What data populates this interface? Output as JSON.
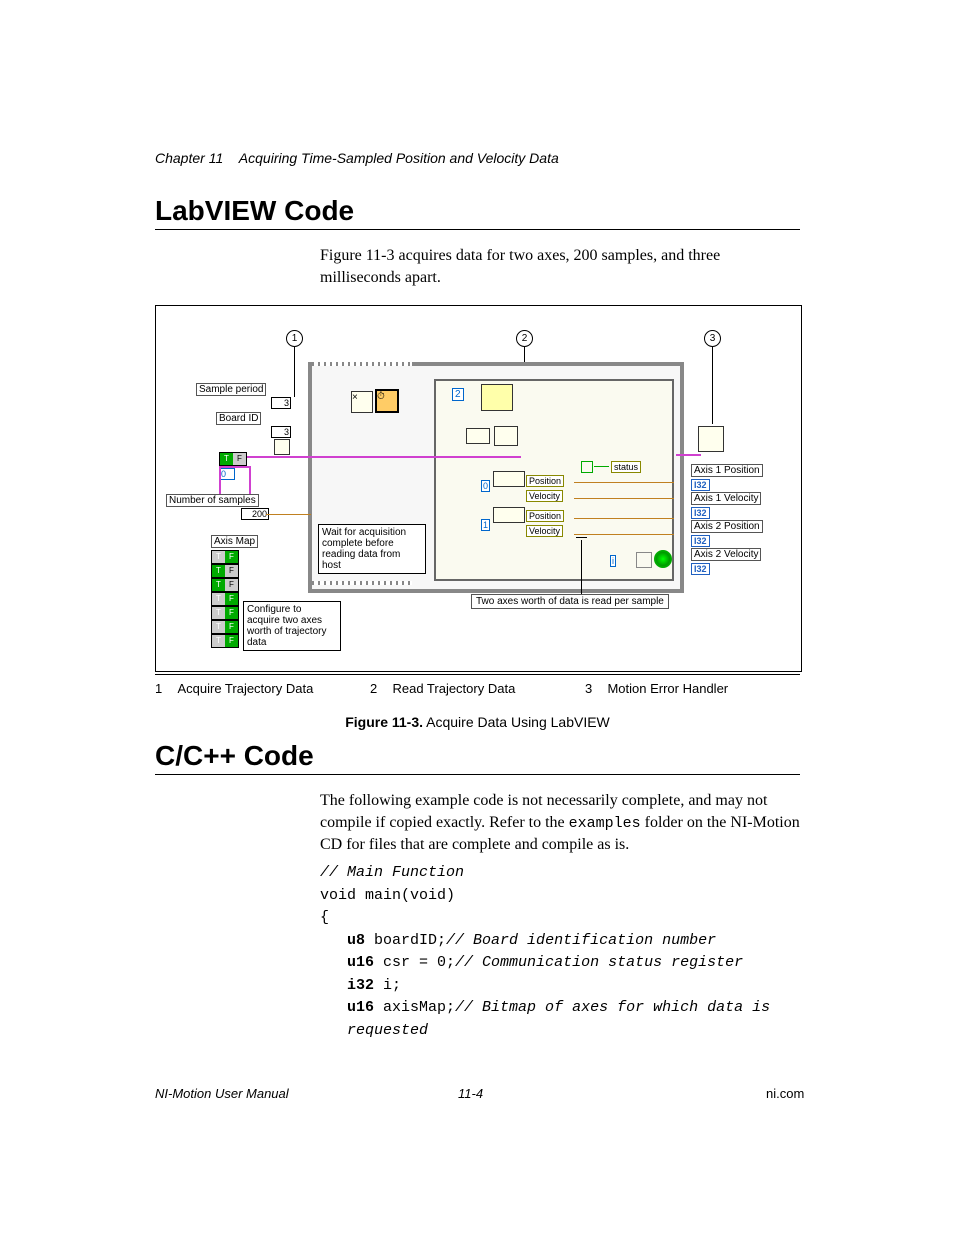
{
  "header": {
    "chapter": "Chapter 11",
    "title": "Acquiring Time-Sampled Position and Velocity Data"
  },
  "sections": {
    "labview": {
      "heading": "LabVIEW Code",
      "intro": "Figure 11-3 acquires data for two axes, 200 samples, and three milliseconds apart."
    },
    "ccpp": {
      "heading": "C/C++ Code",
      "intro_pre": "The following example code is not necessarily complete, and may not compile if copied exactly. Refer to the ",
      "intro_code": "examples",
      "intro_post": " folder on the NI-Motion CD for files that are complete and compile as is."
    }
  },
  "diagram": {
    "callouts": {
      "c1": "1",
      "c2": "2",
      "c3": "3"
    },
    "labels": {
      "sample_period": "Sample period",
      "sample_period_val": "3",
      "board_id": "Board ID",
      "board_id_val": "3",
      "zero": "0",
      "num_samples": "Number of samples",
      "num_samples_val": "200",
      "axis_map": "Axis Map",
      "status": "status",
      "position1": "Position",
      "velocity1": "Velocity",
      "position2": "Position",
      "velocity2": "Velocity",
      "zero2": "0",
      "one": "1",
      "iter": "i",
      "idx2": "2",
      "a1p": "Axis 1 Position",
      "a1v": "Axis 1 Velocity",
      "a2p": "Axis 2 Position",
      "a2v": "Axis 2 Velocity",
      "i32": "I32",
      "note1": "Wait for acquisition complete before reading data from host",
      "note2": "Configure to acquire two axes worth of trajectory data",
      "note3": "Two axes worth of data is read per sample"
    },
    "legend": {
      "n1": "1",
      "l1": "Acquire Trajectory Data",
      "n2": "2",
      "l2": "Read Trajectory Data",
      "n3": "3",
      "l3": "Motion Error Handler"
    }
  },
  "figure_caption": {
    "bold": "Figure 11-3.",
    "rest": "  Acquire Data Using LabVIEW"
  },
  "code": {
    "c1": "// Main Function",
    "l1": "void main(void)",
    "l2": "{",
    "l3_kw": "u8",
    "l3_rest": " boardID;",
    "l3_cm": "// Board identification number",
    "l4_kw": "u16",
    "l4_rest": " csr = 0;",
    "l4_cm": "// Communication status register",
    "l5_kw": "i32",
    "l5_rest": " i;",
    "l6_kw": "u16",
    "l6_rest": " axisMap;",
    "l6_cm": "// Bitmap of axes for which data is ",
    "l7": "requested"
  },
  "footer": {
    "left": "NI-Motion User Manual",
    "center": "11-4",
    "right": "ni.com"
  }
}
